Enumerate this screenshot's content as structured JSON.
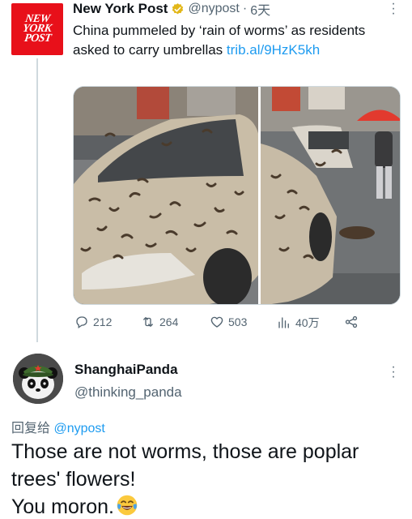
{
  "tweet": {
    "author_name": "New York Post",
    "author_handle": "@nypost",
    "separator": "·",
    "time": "6天",
    "avatar_logo_lines": [
      "NEW",
      "YORK",
      "POST"
    ],
    "text": "China pummeled by ‘rain of worms’ as residents asked to carry umbrellas ",
    "link_text": "trib.al/9HzK5kh",
    "stats": {
      "replies": "212",
      "retweets": "264",
      "likes": "503",
      "views": "40万"
    },
    "icons": [
      "verified-badge-icon",
      "more-icon",
      "reply-icon",
      "retweet-icon",
      "like-icon",
      "views-icon",
      "share-icon"
    ],
    "media_description_colors": {
      "car": "#c8bba6",
      "sky": "#6f7378",
      "umbrella": "#e23a2e"
    }
  },
  "reply": {
    "author_name": "ShanghaiPanda",
    "author_handle": "@thinking_panda",
    "replying_to_prefix": "回复给 ",
    "replying_to_handle": "@nypost",
    "line1": "Those are not worms, those are poplar trees' flowers!",
    "line2": "You moron.",
    "emoji": "face-with-tears-of-joy-icon"
  },
  "colors": {
    "accent": "#1d9bf0",
    "muted": "#536471",
    "text": "#0f1419",
    "brand_red": "#e8101a"
  }
}
